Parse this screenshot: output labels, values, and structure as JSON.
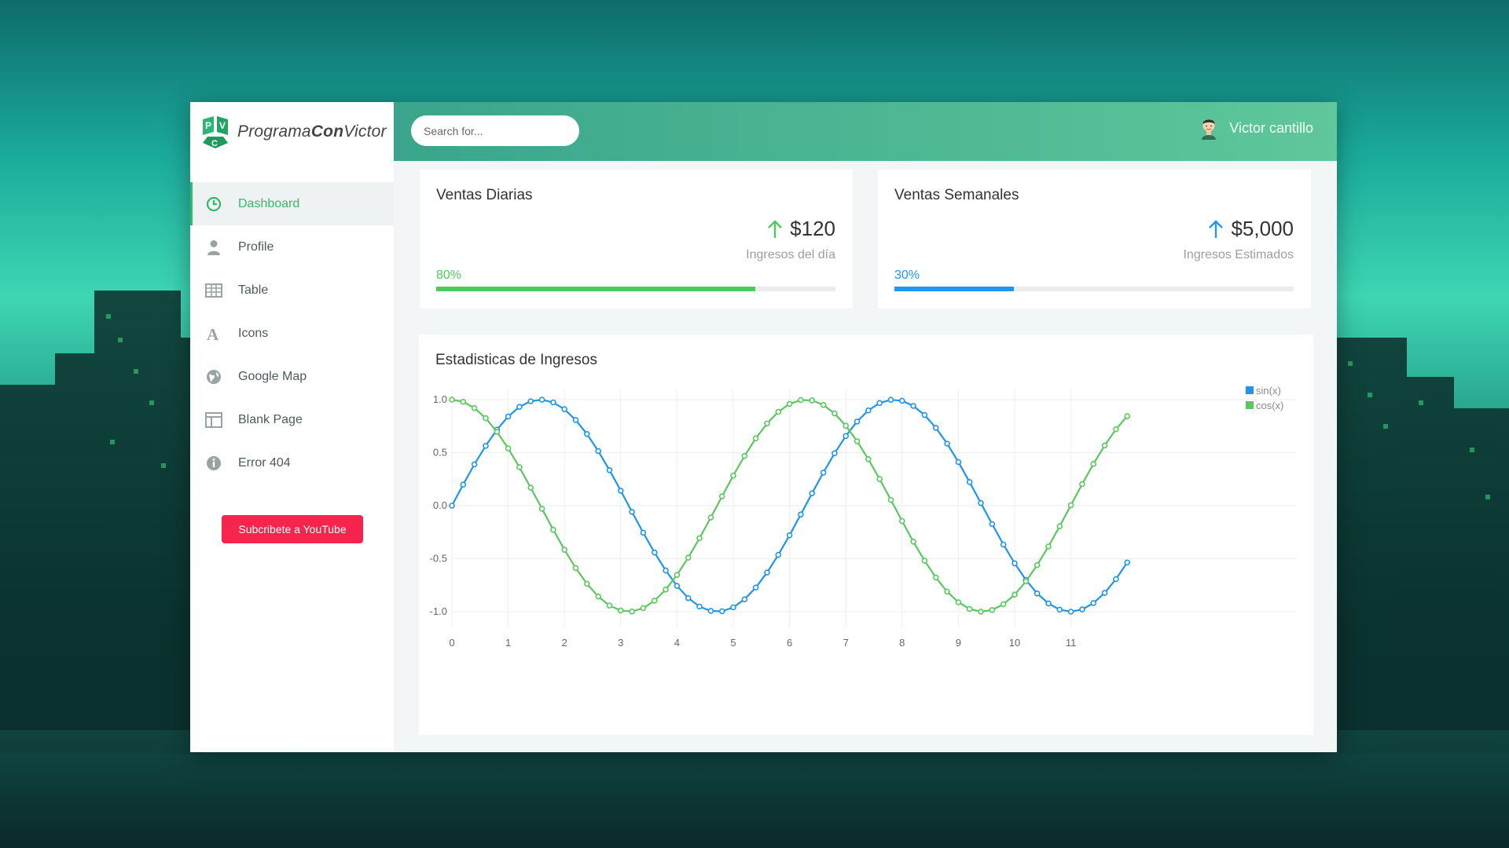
{
  "brand": {
    "name_part1": "Programa",
    "name_part2": "Con",
    "name_part3": "Victor"
  },
  "sidebar": {
    "items": [
      {
        "label": "Dashboard",
        "icon": "dashboard-icon",
        "active": true
      },
      {
        "label": "Profile",
        "icon": "user-icon"
      },
      {
        "label": "Table",
        "icon": "table-icon"
      },
      {
        "label": "Icons",
        "icon": "font-icon"
      },
      {
        "label": "Google Map",
        "icon": "globe-icon"
      },
      {
        "label": "Blank Page",
        "icon": "blank-page-icon"
      },
      {
        "label": "Error 404",
        "icon": "info-icon"
      }
    ],
    "cta_label": "Subcribete a YouTube"
  },
  "topbar": {
    "search_placeholder": "Search for...",
    "user_name": "Victor cantillo"
  },
  "cards": {
    "daily": {
      "title": "Ventas Diarias",
      "value": "$120",
      "subtitle": "Ingresos del día",
      "percent_label": "80%",
      "progress": 0.8,
      "color": "#4cca62"
    },
    "weekly": {
      "title": "Ventas Semanales",
      "value": "$5,000",
      "subtitle": "Ingresos Estimados",
      "percent_label": "30%",
      "progress": 0.3,
      "color": "#2196f3"
    }
  },
  "chart_title": "Estadisticas de Ingresos",
  "colors": {
    "accent_green": "#35b86b",
    "sin": "#2196e6",
    "cos": "#5cc75f",
    "cta": "#f5254d"
  },
  "chart_data": {
    "type": "line",
    "title": "",
    "xlabel": "",
    "ylabel": "",
    "xlim": [
      0,
      12
    ],
    "ylim": [
      -1.0,
      1.0
    ],
    "x_ticks": [
      "0",
      "1",
      "2",
      "3",
      "4",
      "5",
      "6",
      "7",
      "8",
      "9",
      "10",
      "11"
    ],
    "y_ticks": [
      "1.0",
      "0.5",
      "0.0",
      "-0.5",
      "-1.0"
    ],
    "grid": true,
    "legend_position": "top-right",
    "series": [
      {
        "name": "sin(x)",
        "function": "sin",
        "x_start": 0,
        "x_step": 0.2,
        "points": 61
      },
      {
        "name": "cos(x)",
        "function": "cos",
        "x_start": 0,
        "x_step": 0.2,
        "points": 61
      }
    ]
  }
}
